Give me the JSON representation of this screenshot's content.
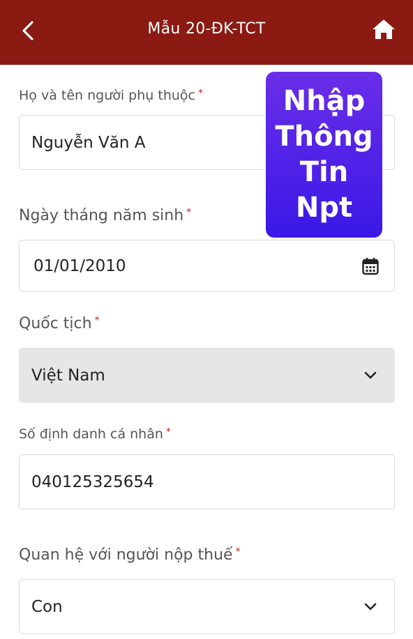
{
  "header": {
    "title": "Mẫu 20-ĐK-TCT",
    "back_icon": "chevron-left-icon",
    "home_icon": "home-icon",
    "background": "#8b1a12"
  },
  "form": {
    "required_mark": "*",
    "full_name": {
      "label": "Họ và tên người phụ thuộc",
      "value": "Nguyễn Văn A"
    },
    "dob": {
      "label": "Ngày tháng năm sinh",
      "value": "01/01/2010",
      "icon": "calendar-icon"
    },
    "nationality": {
      "label": "Quốc tịch",
      "value": "Việt Nam",
      "icon": "chevron-down-icon"
    },
    "personal_id": {
      "label": "Số định danh cá nhân",
      "value": "040125325654"
    },
    "relationship": {
      "label": "Quan hệ với người nộp thuế",
      "value": "Con",
      "icon": "chevron-down-icon"
    }
  },
  "overlay": {
    "lines": [
      "Nhập",
      "Thông",
      "Tin",
      "Npt"
    ],
    "background": "#4a20e6"
  }
}
